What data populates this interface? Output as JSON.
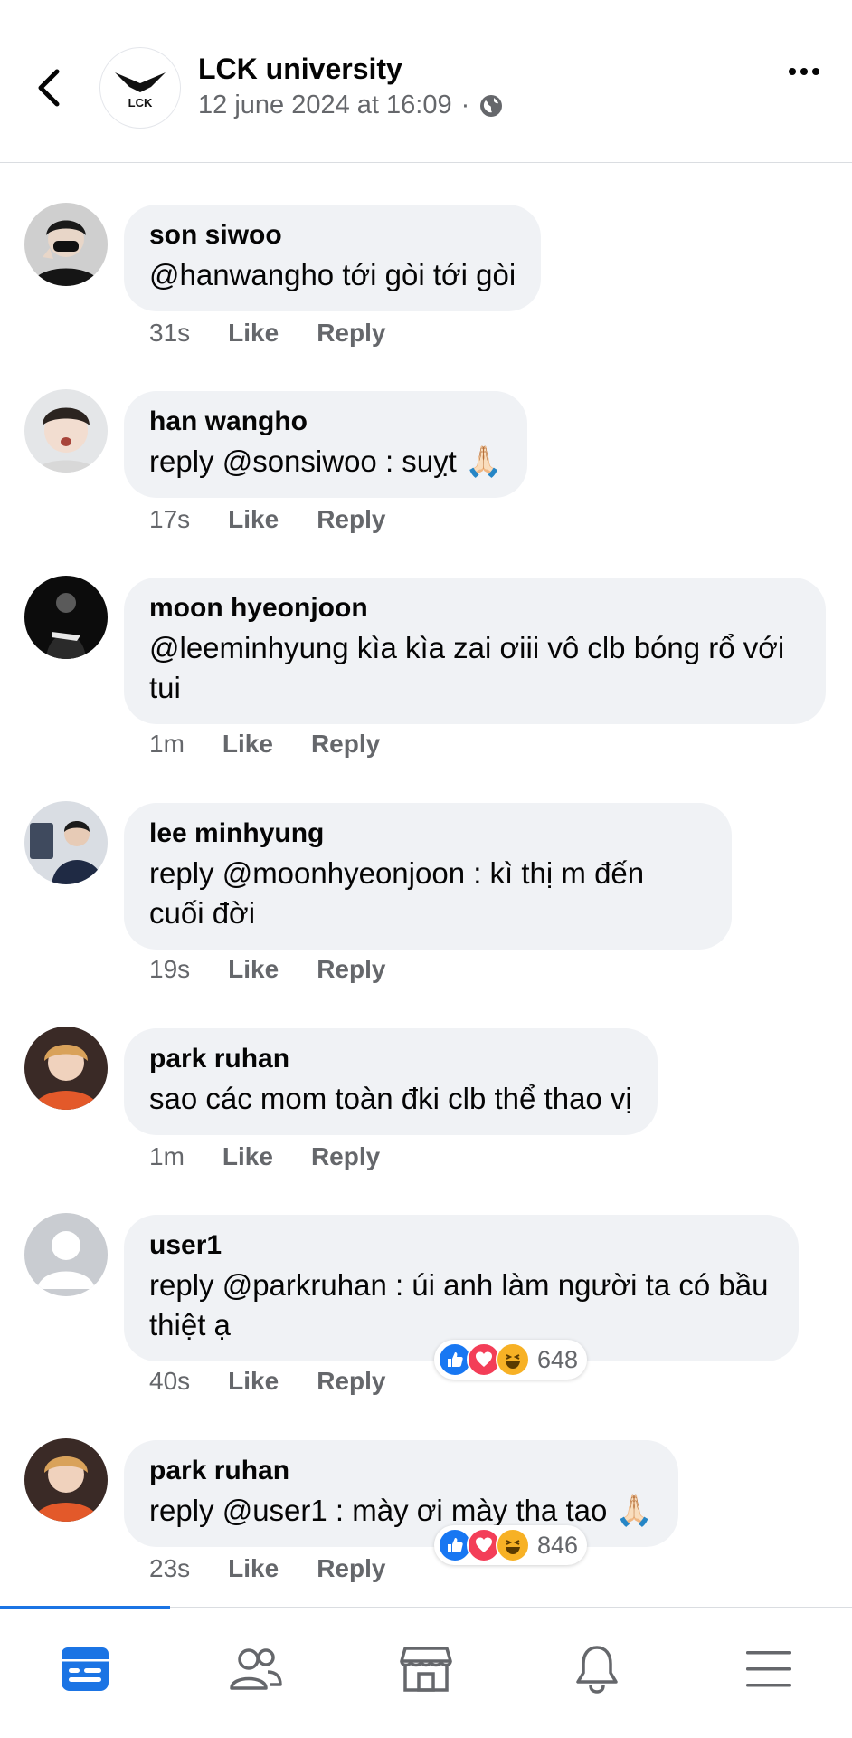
{
  "header": {
    "page_name": "LCK university",
    "post_date": "12 june 2024 at 16:09",
    "separator": "·",
    "logo_text": "LCK"
  },
  "comments": [
    {
      "name": "son siwoo",
      "text": "@hanwangho tới gòi tới gòi",
      "time": "31s",
      "like": "Like",
      "reply": "Reply"
    },
    {
      "name": "han wangho",
      "text": "reply @sonsiwoo : suỵt 🙏🏻",
      "time": "17s",
      "like": "Like",
      "reply": "Reply"
    },
    {
      "name": "moon hyeonjoon",
      "text": "@leeminhyung kìa kìa zai ơiii vô clb bóng rổ với tui",
      "time": "1m",
      "like": "Like",
      "reply": "Reply"
    },
    {
      "name": "lee minhyung",
      "text": "reply @moonhyeonjoon : kì thị m đến cuối đời",
      "time": "19s",
      "like": "Like",
      "reply": "Reply"
    },
    {
      "name": "park ruhan",
      "text": "sao các mom toàn đki clb thể thao vị",
      "time": "1m",
      "like": "Like",
      "reply": "Reply"
    },
    {
      "name": "user1",
      "text": "reply @parkruhan : úi anh làm người ta có bầu thiệt ạ",
      "time": "40s",
      "like": "Like",
      "reply": "Reply",
      "reaction_count": "648"
    },
    {
      "name": "park ruhan",
      "text": "reply @user1 : mày ơi mày tha tao 🙏🏻",
      "time": "23s",
      "like": "Like",
      "reply": "Reply",
      "reaction_count": "846"
    }
  ],
  "colors": {
    "accent": "#1b74e4",
    "bubble": "#f0f2f5",
    "secondary_text": "#65676b",
    "like_blue": "#1877f2",
    "love_red": "#f33e58",
    "haha_yellow": "#f7b125"
  },
  "nav": {
    "items": [
      "feed-icon",
      "friends-icon",
      "marketplace-icon",
      "notifications-icon",
      "menu-icon"
    ],
    "active": "feed-icon"
  }
}
